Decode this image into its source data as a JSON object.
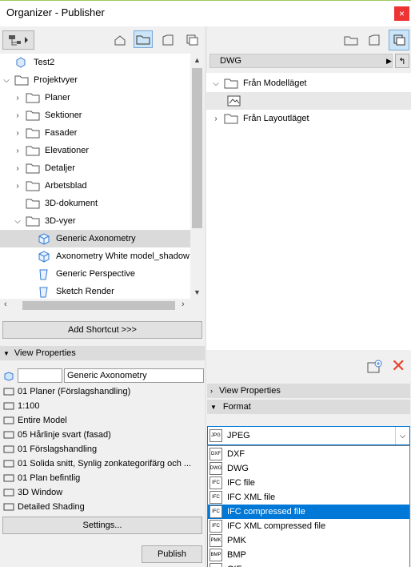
{
  "window": {
    "title": "Organizer - Publisher",
    "close": "×"
  },
  "left_tree": {
    "items": [
      {
        "label": "Test2",
        "indent": 0,
        "chev": "",
        "icon": "root"
      },
      {
        "label": "Projektvyer",
        "indent": 0,
        "chev": "⌵",
        "icon": "folder"
      },
      {
        "label": "Planer",
        "indent": 1,
        "chev": "›",
        "icon": "folder"
      },
      {
        "label": "Sektioner",
        "indent": 1,
        "chev": "›",
        "icon": "folder"
      },
      {
        "label": "Fasader",
        "indent": 1,
        "chev": "›",
        "icon": "folder"
      },
      {
        "label": "Elevationer",
        "indent": 1,
        "chev": "›",
        "icon": "folder"
      },
      {
        "label": "Detaljer",
        "indent": 1,
        "chev": "›",
        "icon": "folder"
      },
      {
        "label": "Arbetsblad",
        "indent": 1,
        "chev": "›",
        "icon": "folder"
      },
      {
        "label": "3D-dokument",
        "indent": 1,
        "chev": "",
        "icon": "folder"
      },
      {
        "label": "3D-vyer",
        "indent": 1,
        "chev": "⌵",
        "icon": "folder"
      },
      {
        "label": "Generic Axonometry",
        "indent": 2,
        "chev": "",
        "icon": "cube",
        "selected": true
      },
      {
        "label": "Axonometry White model_shadow",
        "indent": 2,
        "chev": "",
        "icon": "cube"
      },
      {
        "label": "Generic Perspective",
        "indent": 2,
        "chev": "",
        "icon": "persp"
      },
      {
        "label": "Sketch Render",
        "indent": 2,
        "chev": "",
        "icon": "persp"
      }
    ]
  },
  "add_shortcut": "Add Shortcut >>>",
  "view_properties_left": {
    "header": "View Properties",
    "id_value": "",
    "name_value": "Generic Axonometry",
    "rows": [
      {
        "icon": "layers-icon",
        "text": "01 Planer (Förslagshandling)"
      },
      {
        "icon": "scale-icon",
        "text": "1:100"
      },
      {
        "icon": "model-icon",
        "text": "Entire Model"
      },
      {
        "icon": "pen-icon",
        "text": "05 Hårlinje svart (fasad)"
      },
      {
        "icon": "override-icon",
        "text": "01 Förslagshandling"
      },
      {
        "icon": "section-icon",
        "text": "01 Solida snitt, Synlig zonkategorifärg och ..."
      },
      {
        "icon": "renovation-icon",
        "text": "01 Plan befintlig"
      },
      {
        "icon": "window-icon",
        "text": "3D Window"
      },
      {
        "icon": "shading-icon",
        "text": "Detailed Shading"
      }
    ],
    "settings": "Settings..."
  },
  "publish": "Publish",
  "right": {
    "path": "DWG",
    "tree": [
      {
        "label": "Från Modelläget",
        "chev": "⌵"
      },
      {
        "label": "",
        "chev": "",
        "icon": "item"
      },
      {
        "label": "Från Layoutläget",
        "chev": "›"
      }
    ],
    "view_properties": "View Properties",
    "format": "Format",
    "format_selected": "JPEG",
    "options": [
      {
        "label": "DXF",
        "icon": "DXF"
      },
      {
        "label": "DWG",
        "icon": "DWG"
      },
      {
        "label": "IFC file",
        "icon": "IFC"
      },
      {
        "label": "IFC XML file",
        "icon": "IFC"
      },
      {
        "label": "IFC compressed file",
        "icon": "IFC",
        "selected": true
      },
      {
        "label": "IFC XML compressed file",
        "icon": "IFC"
      },
      {
        "label": "PMK",
        "icon": "PMK"
      },
      {
        "label": "BMP",
        "icon": "BMP"
      },
      {
        "label": "GIF",
        "icon": "GIF"
      }
    ]
  },
  "colors": {
    "selection": "#0078d7",
    "close": "#e33",
    "delete": "#e8432c"
  }
}
